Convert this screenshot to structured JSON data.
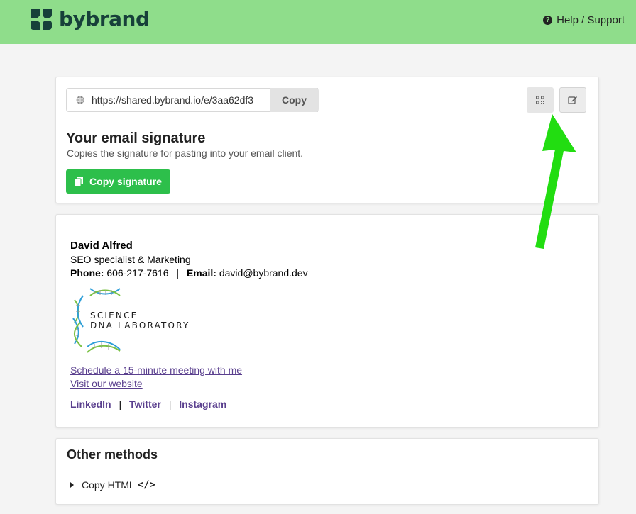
{
  "header": {
    "brand": "bybrand",
    "help_label": "Help / Support",
    "help_icon": "question-circle-icon",
    "bg_color": "#8fdd8b"
  },
  "share": {
    "url": "https://shared.bybrand.io/e/3aa62df3",
    "copy_label": "Copy",
    "qr_icon": "qr-code-icon",
    "edit_icon": "edit-icon"
  },
  "signature_panel": {
    "title": "Your email signature",
    "subtitle": "Copies the signature for pasting into your email client.",
    "copy_button": "Copy signature",
    "button_color": "#2dbf4b"
  },
  "signature": {
    "name": "David Alfred",
    "role": "SEO specialist & Marketing",
    "phone_label": "Phone:",
    "phone": "606-217-7616",
    "divider": "|",
    "email_label": "Email:",
    "email": "david@bybrand.dev",
    "logo_line1": "SCIENCE",
    "logo_line2": "DNA LABORATORY",
    "meeting_link": "Schedule a 15-minute meeting with me",
    "website_link": "Visit our website",
    "social": [
      "LinkedIn",
      "Twitter",
      "Instagram"
    ],
    "link_color": "#5a3f8e"
  },
  "other_methods": {
    "title": "Other methods",
    "copy_html": "Copy HTML",
    "code_icon": "code-icon"
  },
  "annotation": {
    "arrow_color": "#22dd11"
  }
}
